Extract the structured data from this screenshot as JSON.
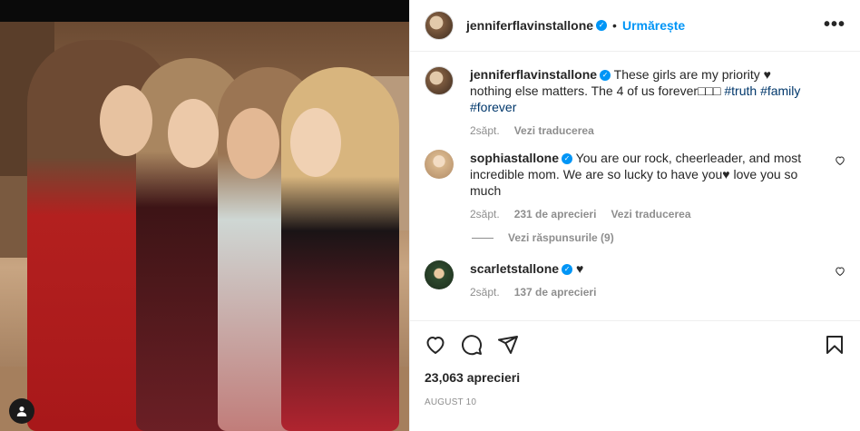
{
  "post": {
    "username": "jenniferflavinstallone",
    "follow_label": "Urmărește",
    "separator": "•",
    "more_label": "•••"
  },
  "caption": {
    "username": "jenniferflavinstallone",
    "text": " These girls are my priority ♥ nothing else matters. The 4 of us forever□□□ ",
    "hashtags": [
      "#truth",
      "#family",
      "#forever"
    ],
    "time": "2săpt.",
    "translate": "Vezi traducerea"
  },
  "comments": [
    {
      "username": "sophiastallone",
      "text": " You are our rock, cheerleader, and most incredible mom. We are so lucky to have you♥ love you so much",
      "time": "2săpt.",
      "likes": "231 de aprecieri",
      "translate": "Vezi traducerea"
    },
    {
      "username": "scarletstallone",
      "text": " ♥",
      "time": "2săpt.",
      "likes": "137 de aprecieri"
    }
  ],
  "replies_label": "Vezi răspunsurile (9)",
  "likes_count": "23,063 aprecieri",
  "date": "AUGUST 10",
  "icons": {
    "like": "heart-icon",
    "comment": "comment-bubble-icon",
    "share": "paper-plane-icon",
    "save": "bookmark-icon",
    "tag": "user-tag-icon"
  },
  "colors": {
    "accent": "#0095f6",
    "verified": "#0095f6",
    "muted": "#8e8e8e",
    "hashtag": "#00376b"
  }
}
